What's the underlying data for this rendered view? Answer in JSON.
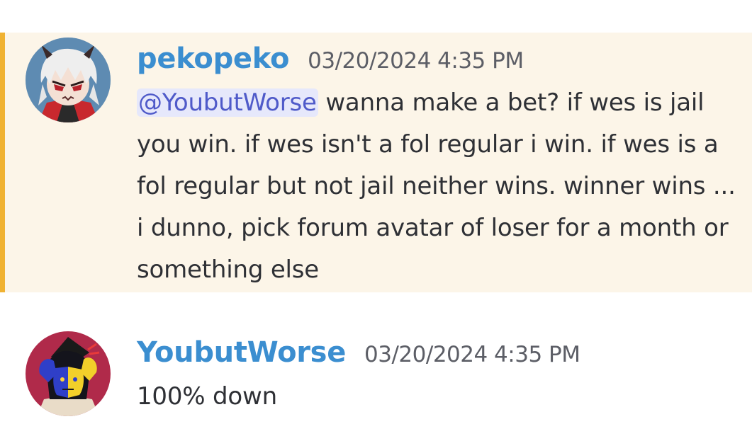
{
  "messages": [
    {
      "username": "pekopeko",
      "timestamp": "03/20/2024 4:35 PM",
      "mention": "@YoubutWorse",
      "text": " wanna make a bet? if wes is jail you win. if wes isn't a fol regular i win. if wes is a fol regular but not jail neither wins. winner wins ... i dunno, pick forum avatar of loser for a month or something else",
      "highlighted": true,
      "avatar_icon": "white-haired-anime-avatar"
    },
    {
      "username": "YoubutWorse",
      "timestamp": "03/20/2024 4:35 PM",
      "text": "100% down",
      "highlighted": false,
      "avatar_icon": "blue-yellow-split-face-avatar"
    }
  ],
  "colors": {
    "highlight_bg": "#fcf5e8",
    "mention_bar": "#f0b232",
    "username": "#3b8ed0",
    "mention_bg": "#e6e8fb",
    "mention_text": "#4f5ac9"
  }
}
